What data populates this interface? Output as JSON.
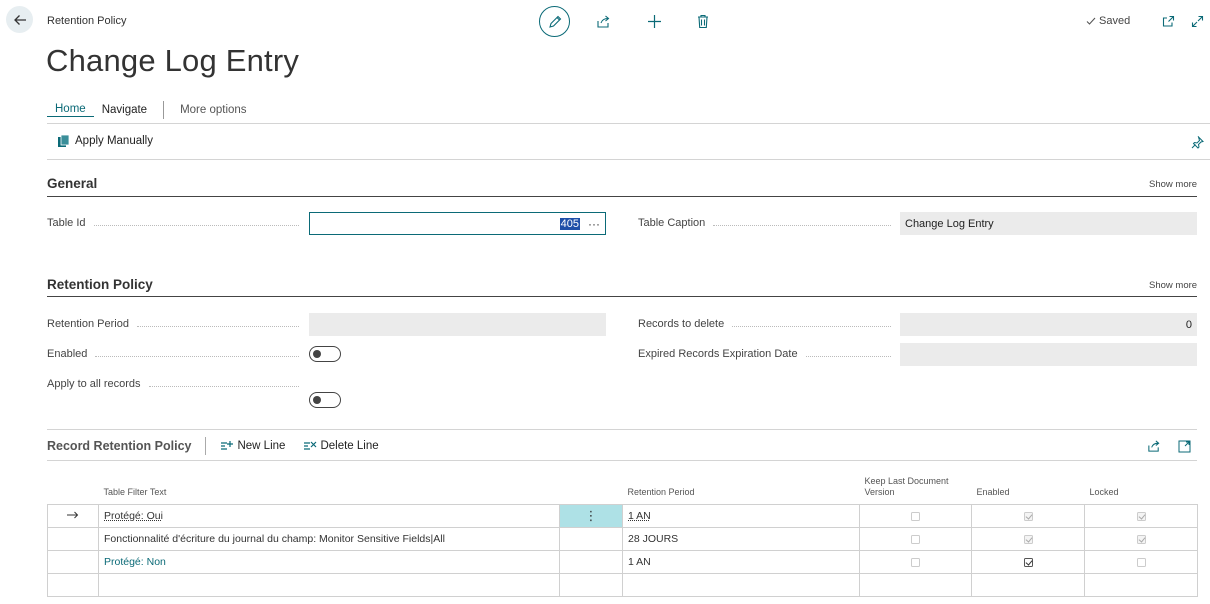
{
  "header": {
    "breadcrumb": "Retention Policy",
    "title": "Change Log Entry",
    "saved_label": "Saved"
  },
  "menu": {
    "home": "Home",
    "navigate": "Navigate",
    "more_options": "More options"
  },
  "actions": {
    "apply_manually": "Apply Manually"
  },
  "general": {
    "title": "General",
    "show_more": "Show more",
    "table_id_label": "Table Id",
    "table_id_value": "405",
    "table_caption_label": "Table Caption",
    "table_caption_value": "Change Log Entry"
  },
  "retention": {
    "title": "Retention Policy",
    "show_more": "Show more",
    "period_label": "Retention Period",
    "period_value": "",
    "enabled_label": "Enabled",
    "enabled_value": false,
    "apply_all_label": "Apply to all records",
    "apply_all_value": false,
    "records_delete_label": "Records to delete",
    "records_delete_value": "0",
    "expired_label": "Expired Records Expiration Date",
    "expired_value": ""
  },
  "record_policy": {
    "title": "Record Retention Policy",
    "new_line": "New Line",
    "delete_line": "Delete Line",
    "columns": {
      "filter": "Table Filter Text",
      "period": "Retention Period",
      "keep_last": "Keep Last Document Version",
      "enabled": "Enabled",
      "locked": "Locked"
    },
    "rows": [
      {
        "filter": "Protégé: Oui",
        "period": "1 AN",
        "keep_last": false,
        "enabled": true,
        "locked": true
      },
      {
        "filter": "Fonctionnalité d'écriture du journal du champ: Monitor Sensitive Fields|All",
        "period": "28 JOURS",
        "keep_last": false,
        "enabled": true,
        "locked": true
      },
      {
        "filter": "Protégé: Non",
        "period": "1 AN",
        "keep_last": false,
        "enabled": true,
        "locked": false
      }
    ]
  },
  "colors": {
    "accent": "#0b6a77",
    "selection": "#1f4fa8",
    "field_bg": "#ebebeb"
  }
}
